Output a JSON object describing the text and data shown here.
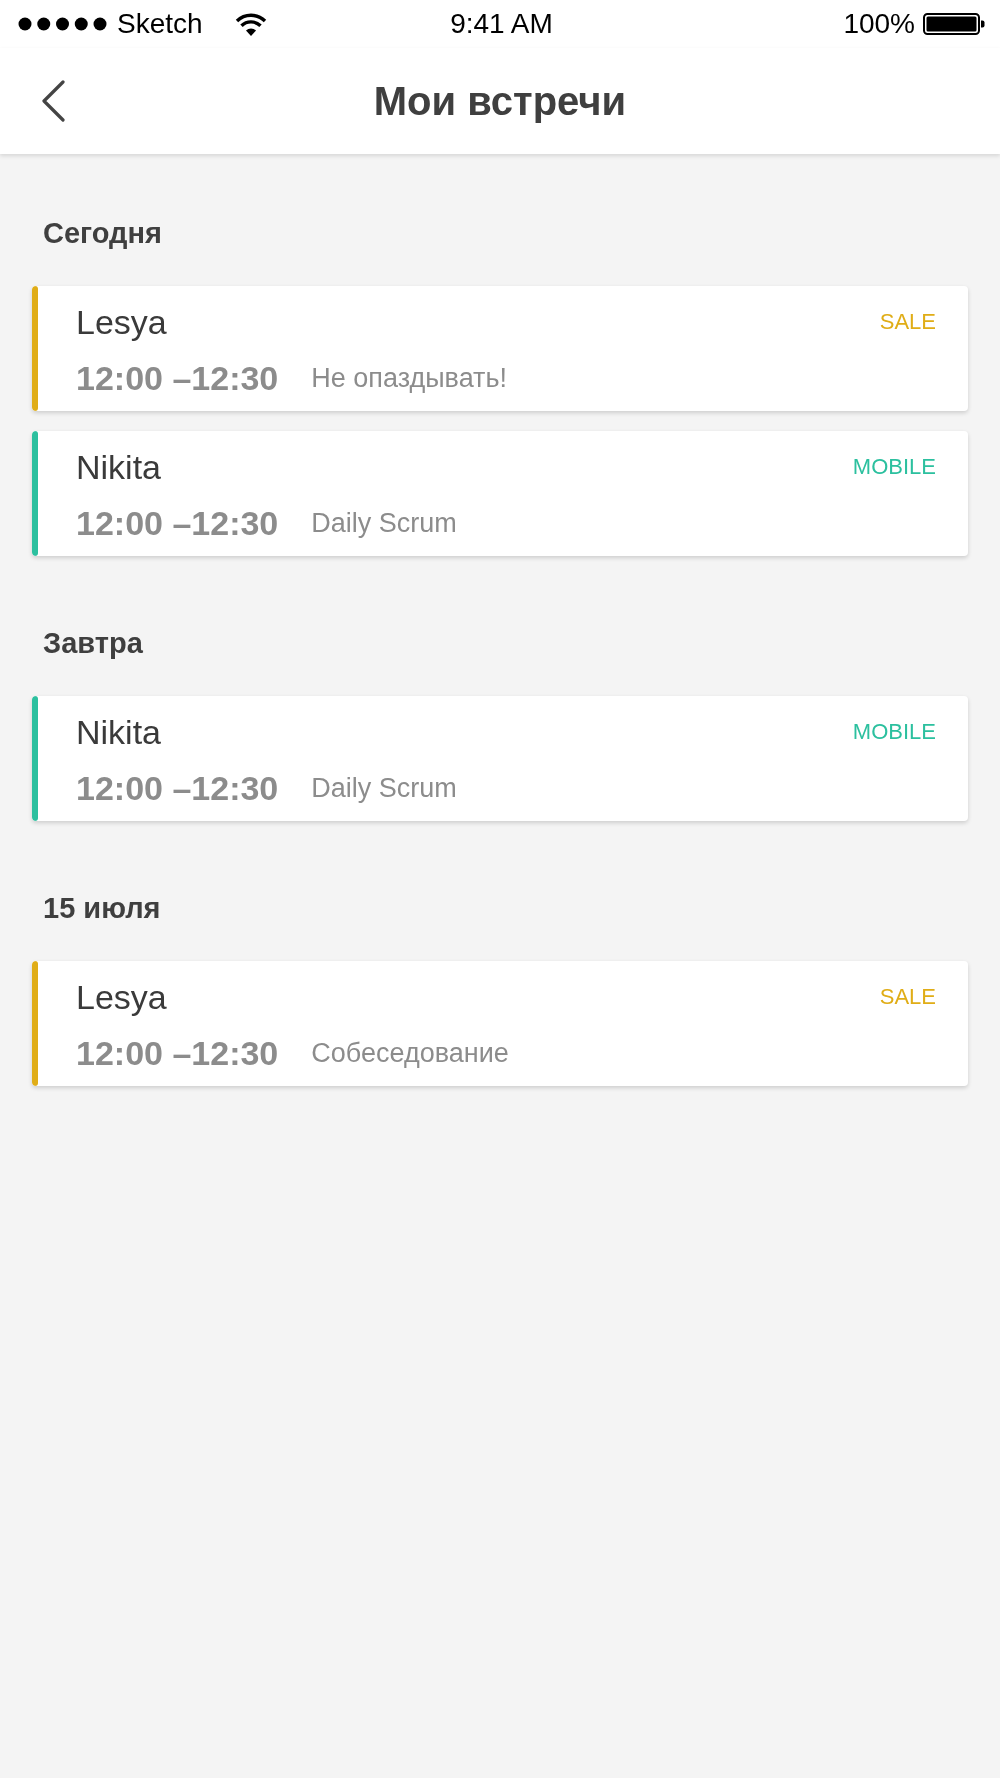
{
  "status_bar": {
    "carrier": "Sketch",
    "time": "9:41 AM",
    "battery": "100%"
  },
  "header": {
    "title": "Мои встречи"
  },
  "sections": [
    {
      "title": "Сегодня",
      "meetings": [
        {
          "name": "Lesya",
          "time": "12:00 –12:30",
          "note": "Не опаздывать!",
          "tag": "SALE",
          "color": "#e0ad17"
        },
        {
          "name": "Nikita",
          "time": "12:00 –12:30",
          "note": "Daily Scrum",
          "tag": "MOBILE",
          "color": "#2cc09f"
        }
      ]
    },
    {
      "title": "Завтра",
      "meetings": [
        {
          "name": "Nikita",
          "time": "12:00 –12:30",
          "note": "Daily Scrum",
          "tag": "MOBILE",
          "color": "#2cc09f"
        }
      ]
    },
    {
      "title": "15 июля",
      "meetings": [
        {
          "name": "Lesya",
          "time": "12:00 –12:30",
          "note": "Собеседование",
          "tag": "SALE",
          "color": "#e0ad17"
        }
      ]
    }
  ]
}
